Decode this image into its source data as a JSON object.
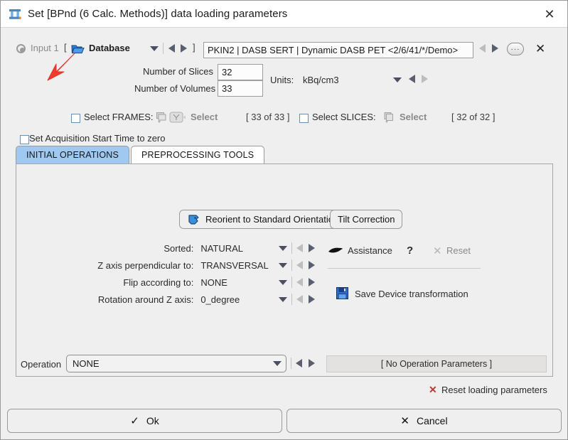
{
  "window": {
    "title": "Set  [BPnd (6 Calc. Methods)] data loading parameters",
    "app_icon": "pi-matrix-icon",
    "close_label": "✕"
  },
  "input_row": {
    "radio_label": "Input 1",
    "bracket_open": "[",
    "bracket_close": "]",
    "source_icon": "open-folder-icon",
    "source_label": "Database",
    "dropdown_icon": "chevron-down-icon",
    "prev_icon": "triangle-left-icon",
    "next_icon": "triangle-right-icon",
    "path_value": "PKIN2 | DASB SERT | Dynamic DASB PET <2/6/41/*/Demo>",
    "path_prev_icon": "triangle-left-icon",
    "path_next_icon": "triangle-right-icon",
    "more_label": "···",
    "clear_label": "✕",
    "annotation_icon": "red-arrow-annotation"
  },
  "dimensions": {
    "slices_label": "Number of Slices",
    "slices_value": "32",
    "volumes_label": "Number of Volumes",
    "volumes_value": "33",
    "units_label": "Units:",
    "units_value": "kBq/cm3",
    "units_dropdown_icon": "chevron-down-icon",
    "units_prev_icon": "triangle-left-icon",
    "units_next_icon": "triangle-right-icon"
  },
  "selection": {
    "frames_checkbox_label": "Select FRAMES:",
    "frames_icon": "frames-stack-icon",
    "frames_y_icon": "y-branch-icon",
    "frames_select_label": "Select",
    "frames_count": "[ 33 of 33 ]",
    "slices_checkbox_label": "Select SLICES:",
    "slices_icon": "slices-stack-icon",
    "slices_select_label": "Select",
    "slices_count": "[ 32 of 32 ]"
  },
  "acq": {
    "zero_start_label": "Set Acquisition Start Time to zero"
  },
  "tabs": [
    {
      "label": "INITIAL OPERATIONS",
      "active": true
    },
    {
      "label": "PREPROCESSING TOOLS",
      "active": false
    }
  ],
  "panel": {
    "reorient_button": "Reorient to Standard Orientation",
    "reorient_icon": "head-profile-icon",
    "tilt_button": "Tilt Correction",
    "fields": [
      {
        "label": "Sorted:",
        "value": "NATURAL"
      },
      {
        "label": "Z axis perpendicular to:",
        "value": "TRANSVERSAL"
      },
      {
        "label": "Flip according to:",
        "value": "NONE"
      },
      {
        "label": "Rotation around Z axis:",
        "value": "0_degree"
      }
    ],
    "assistance_label": "Assistance",
    "assistance_icon": "pointer-device-icon",
    "help_label": "?",
    "reset_label": "Reset",
    "reset_icon": "x-icon",
    "save_label": "Save Device transformation",
    "save_icon": "floppy-disk-icon"
  },
  "operation": {
    "label": "Operation",
    "value": "NONE",
    "dropdown_icon": "chevron-down-icon",
    "prev_icon": "triangle-left-icon",
    "next_icon": "triangle-right-icon",
    "params_text": "[ No Operation Parameters ]"
  },
  "reset_loading": {
    "icon": "x-icon",
    "label": "Reset loading parameters"
  },
  "footer": {
    "ok_label": "Ok",
    "ok_icon": "check-icon",
    "cancel_label": "Cancel",
    "cancel_icon": "x-icon"
  },
  "colors": {
    "accent_tab": "#9fc9f0",
    "annotation_red": "#e8342a",
    "icon_blue": "#1f6fd0",
    "reset_red": "#c0392b"
  }
}
